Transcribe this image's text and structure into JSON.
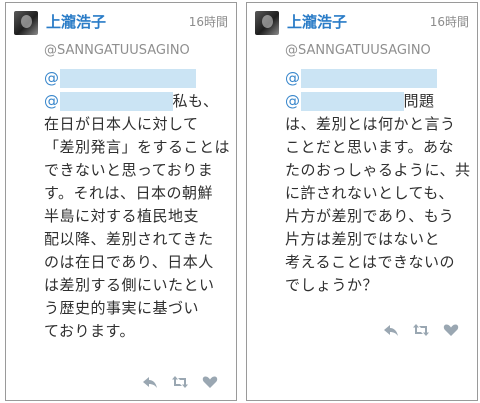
{
  "tweets": [
    {
      "display_name": "上瀧浩子",
      "time": "16時間",
      "handle": "@SANNGATUUSAGINO",
      "mention1": "@",
      "mention2": "@",
      "mention2_suffix": "私も、",
      "lines": [
        "在日が日本人に対して",
        "「差別発言」をすることは",
        "できないと思っておりま",
        "す。それは、日本の朝鮮",
        "半島に対する植民地支",
        "配以降、差別されてきた",
        "のは在日であり、日本人",
        "は差別する側にいたとい",
        "う歴史的事実に基づい",
        "ております。"
      ],
      "actions": [
        "reply-icon",
        "retweet-icon",
        "favorite-icon"
      ]
    },
    {
      "display_name": "上瀧浩子",
      "time": "16時間",
      "handle": "@SANNGATUUSAGINO",
      "mention1": "@",
      "mention2": "@",
      "mention2_suffix": "問題",
      "lines": [
        "は、差別とは何かと言う",
        "ことだと思います。あな",
        "たのおっしゃるように、共",
        "に許されないとしても、",
        "片方が差別であり、もう",
        "片方は差別ではないと",
        "考えることはできないの",
        "でしょうか？"
      ],
      "actions": [
        "reply-icon",
        "retweet-icon",
        "favorite-icon"
      ]
    }
  ],
  "colors": {
    "name": "#2a7cc7",
    "mention": "#3b88cc",
    "redaction": "#cbe4f4",
    "meta": "#8f8f8f",
    "icon": "#9aa7b2",
    "border": "#9a9a9a"
  }
}
